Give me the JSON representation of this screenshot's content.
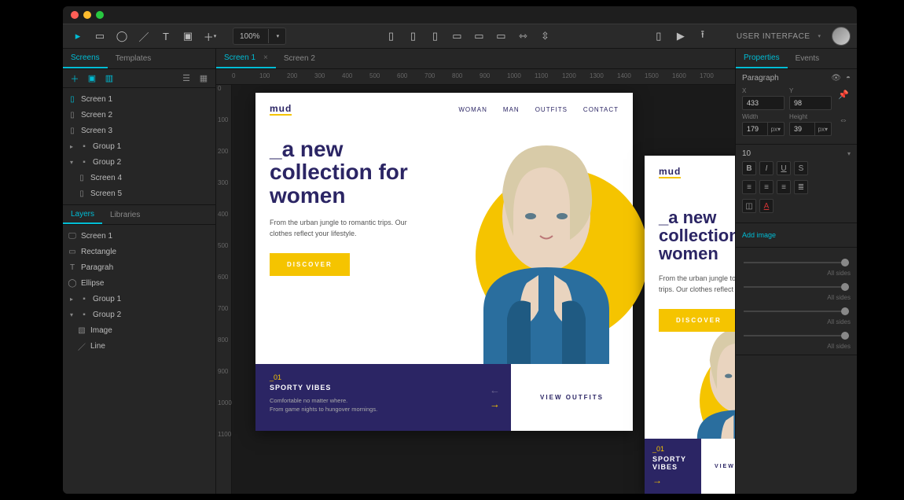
{
  "toolbar": {
    "zoom": "100%",
    "page_label": "USER INTERFACE"
  },
  "left": {
    "tabs": {
      "screens": "Screens",
      "templates": "Templates"
    },
    "screens": [
      "Screen 1",
      "Screen 2",
      "Screen 3"
    ],
    "group1": "Group 1",
    "group2": "Group 2",
    "group2_children": [
      "Screen 4",
      "Screen 5"
    ],
    "tabs2": {
      "layers": "Layers",
      "libraries": "Libraries"
    },
    "layers_root": "Screen 1",
    "layers": [
      "Rectangle",
      "Paragrah",
      "Ellipse"
    ],
    "lgroup1": "Group 1",
    "lgroup2": "Group 2",
    "lgroup2_children": [
      "Image",
      "Line"
    ]
  },
  "doc_tabs": [
    "Screen 1",
    "Screen 2"
  ],
  "ruler_h": [
    "0",
    "100",
    "200",
    "300",
    "400",
    "500",
    "600",
    "700",
    "800",
    "900",
    "1000",
    "1100",
    "1200",
    "1300",
    "1400",
    "1500",
    "1600",
    "1700"
  ],
  "ruler_v": [
    "0",
    "100",
    "200",
    "300",
    "400",
    "500",
    "600",
    "700",
    "800",
    "900",
    "1000",
    "1100"
  ],
  "design": {
    "logo": "mud",
    "nav": [
      "WOMAN",
      "MAN",
      "OUTFITS",
      "CONTACT"
    ],
    "headline": "_a new collection for women",
    "sub": "From the urban jungle to romantic trips. Our clothes reflect your lifestyle.",
    "cta": "DISCOVER",
    "foot_num": "_01",
    "foot_title": "SPORTY VIBES",
    "foot_desc1": "Comfortable no matter where.",
    "foot_desc2": "From game nights to hungover mornings.",
    "foot_link": "VIEW OUTFITS",
    "mobile_foot_title": "SPORTY VIBES"
  },
  "right": {
    "tabs": {
      "properties": "Properties",
      "events": "Events"
    },
    "element": "Paragraph",
    "x_label": "X",
    "y_label": "Y",
    "x": "433",
    "y": "98",
    "w_label": "Width",
    "h_label": "Height",
    "w": "179",
    "h": "39",
    "unit": "px",
    "font_size": "10",
    "add_image": "Add image",
    "sides": "All sides"
  }
}
